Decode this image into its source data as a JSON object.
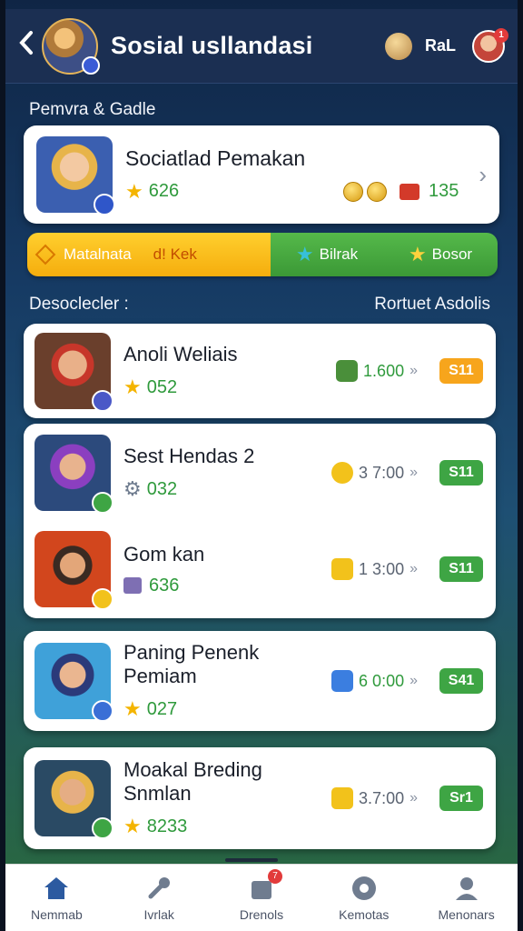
{
  "header": {
    "back_icon": "chevron-left-icon",
    "title": "Sosial usllandasi",
    "user_label": "RaL",
    "notif_count": "1"
  },
  "section1": {
    "label": "Pemvra & Gadle"
  },
  "profile": {
    "name": "Sociatlad Pemakan",
    "stars": "626",
    "gems": "135"
  },
  "tabs": {
    "tab1_label": "Matalnata",
    "tab1_sub": "d! Kek",
    "tab2_label": "Bilrak",
    "tab3_label": "Bosor"
  },
  "list": {
    "left_header": "Desoclecler :",
    "right_header": "Rortuet Asdolis",
    "items": [
      {
        "name": "Anoli Weliais",
        "score": "052",
        "reward": "1.600",
        "pill": "S11",
        "pill_color": "#f7a51c"
      },
      {
        "name": "Sest Hendas 2",
        "score": "032",
        "reward": "3 7:00",
        "pill": "S11",
        "pill_color": "#3ea544"
      },
      {
        "name": "Gom kan",
        "score": "636",
        "reward": "1 3:00",
        "pill": "S11",
        "pill_color": "#3ea544"
      },
      {
        "name": "Paning Penenk Pemiam",
        "score": "027",
        "reward": "6 0:00",
        "pill": "S41",
        "pill_color": "#3ea544"
      },
      {
        "name": "Moakal Breding Snmlan",
        "score": "8233",
        "reward": "3.7:00",
        "pill": "Sr1",
        "pill_color": "#3ea544"
      }
    ]
  },
  "nav": {
    "items": [
      {
        "label": "Nemmab",
        "icon": "home-icon"
      },
      {
        "label": "Ivrlak",
        "icon": "tools-icon"
      },
      {
        "label": "Drenols",
        "icon": "shop-icon",
        "badge": "7"
      },
      {
        "label": "Kemotas",
        "icon": "ball-icon"
      },
      {
        "label": "Menonars",
        "icon": "person-icon"
      }
    ]
  }
}
